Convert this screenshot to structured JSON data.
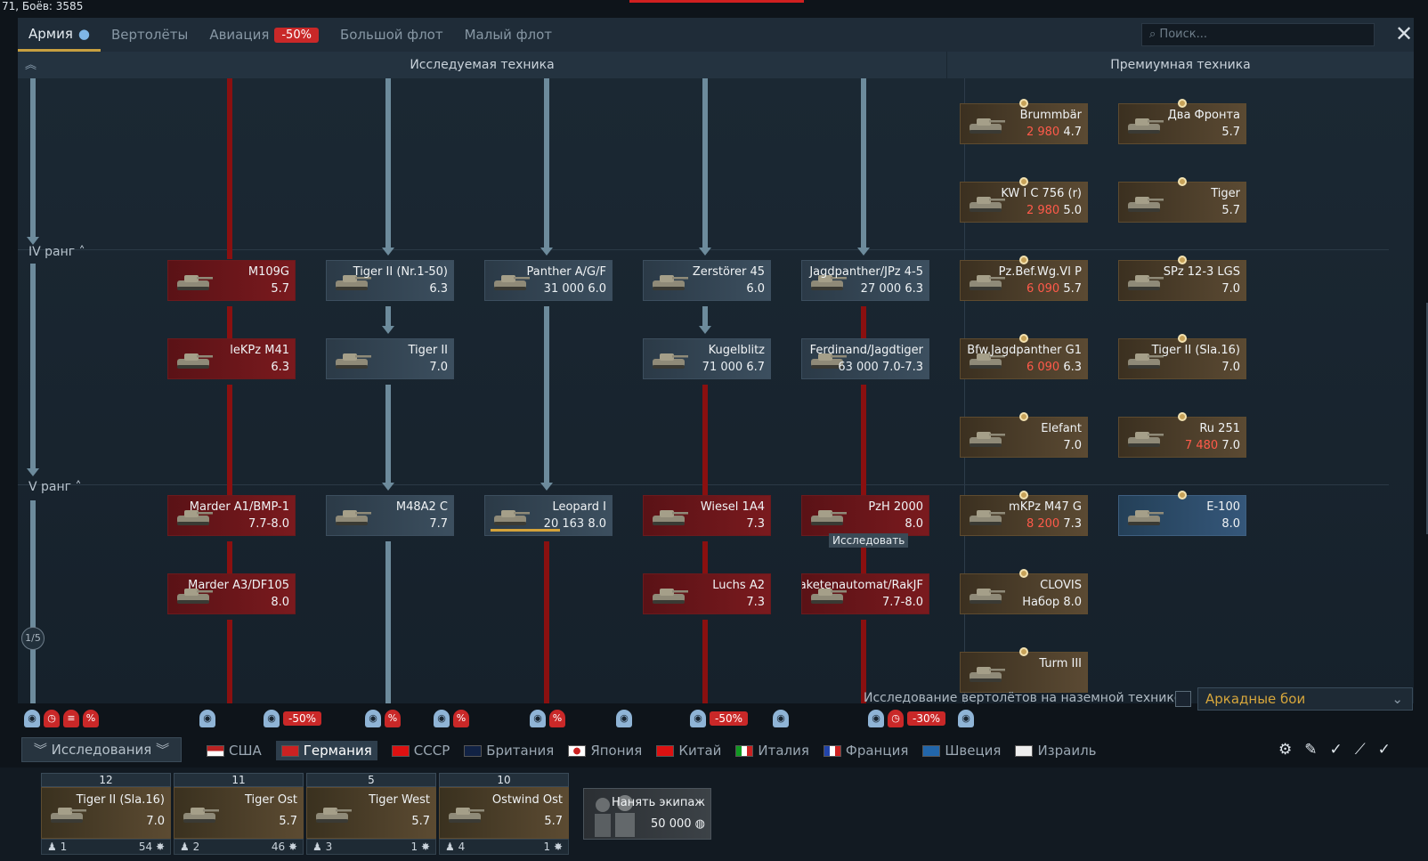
{
  "status_text": "71, Боёв: 3585",
  "tabs": [
    {
      "label": "Армия",
      "badge": ""
    },
    {
      "label": "Вертолёты",
      "badge": ""
    },
    {
      "label": "Авиация",
      "badge": "-50%"
    },
    {
      "label": "Большой флот",
      "badge": ""
    },
    {
      "label": "Малый флот",
      "badge": ""
    }
  ],
  "search_placeholder": "Поиск...",
  "headers": {
    "researchable": "Исследуемая техника",
    "premium": "Премиумная техника"
  },
  "ranks": {
    "r4": "IV ранг",
    "r5": "V ранг"
  },
  "tech_cards": [
    {
      "name": "M109G",
      "br": "5.7",
      "cost": "",
      "rp": "",
      "style": "loc"
    },
    {
      "name": "Tiger II (Nr.1-50)",
      "br": "6.3",
      "cost": "",
      "rp": "",
      "style": "std"
    },
    {
      "name": "Panther A/G/F",
      "br": "6.0",
      "cost": "",
      "rp": "31 000",
      "style": "std"
    },
    {
      "name": "Zerstörer 45",
      "br": "6.0",
      "cost": "",
      "rp": "",
      "style": "std"
    },
    {
      "name": "Jagdpanther/JPz 4-5",
      "br": "6.3",
      "cost": "",
      "rp": "27 000",
      "style": "std"
    },
    {
      "name": "leKPz M41",
      "br": "6.3",
      "cost": "",
      "rp": "",
      "style": "loc"
    },
    {
      "name": "Tiger II",
      "br": "7.0",
      "cost": "",
      "rp": "",
      "style": "std"
    },
    {
      "name": "Kugelblitz",
      "br": "6.7",
      "cost": "",
      "rp": "71 000",
      "style": "std"
    },
    {
      "name": "Ferdinand/Jagdtiger",
      "br": "7.0-7.3",
      "cost": "",
      "rp": "63 000",
      "style": "std"
    },
    {
      "name": "Marder A1/BMP-1",
      "br": "7.7-8.0",
      "cost": "",
      "rp": "",
      "style": "loc"
    },
    {
      "name": "M48A2 C",
      "br": "7.7",
      "cost": "",
      "rp": "",
      "style": "std"
    },
    {
      "name": "Leopard I",
      "br": "8.0",
      "cost": "",
      "rp": "20 163",
      "style": "std"
    },
    {
      "name": "Wiesel 1A4",
      "br": "7.3",
      "cost": "",
      "rp": "",
      "style": "loc"
    },
    {
      "name": "PzH 2000",
      "br": "8.0",
      "cost": "",
      "rp": "",
      "style": "loc"
    },
    {
      "name": "Marder A3/DF105",
      "br": "8.0",
      "cost": "",
      "rp": "",
      "style": "loc"
    },
    {
      "name": "Luchs A2",
      "br": "7.3",
      "cost": "",
      "rp": "",
      "style": "loc"
    },
    {
      "name": "Raketenautomat/RakJF",
      "br": "7.7-8.0",
      "cost": "",
      "rp": "",
      "style": "loc"
    }
  ],
  "research_tooltip": "Исследовать",
  "premium_cards": [
    {
      "name": "Brummbär",
      "br": "4.7",
      "cost": "2 980",
      "style": "prem"
    },
    {
      "name": "Два Фронта",
      "br": "5.7",
      "cost": "",
      "style": "prem"
    },
    {
      "name": "KW I C 756 (r)",
      "br": "5.0",
      "cost": "2 980",
      "style": "prem"
    },
    {
      "name": "Tiger",
      "br": "5.7",
      "cost": "",
      "style": "prem"
    },
    {
      "name": "Pz.Bef.Wg.VI P",
      "br": "5.7",
      "cost": "6 090",
      "style": "prem"
    },
    {
      "name": "SPz 12-3 LGS",
      "br": "7.0",
      "cost": "",
      "style": "prem"
    },
    {
      "name": "Bfw.Jagdpanther G1",
      "br": "6.3",
      "cost": "6 090",
      "style": "prem"
    },
    {
      "name": "Tiger II (Sla.16)",
      "br": "7.0",
      "cost": "",
      "style": "prem"
    },
    {
      "name": "Elefant",
      "br": "7.0",
      "cost": "",
      "style": "prem"
    },
    {
      "name": "Ru 251",
      "br": "7.0",
      "cost": "7 480",
      "style": "prem"
    },
    {
      "name": "mKPz M47 G",
      "br": "7.3",
      "cost": "8 200",
      "style": "prem"
    },
    {
      "name": "E-100",
      "br": "8.0",
      "cost": "",
      "style": "sq"
    },
    {
      "name": "CLOVIS",
      "br": "Набор 8.0",
      "cost": "",
      "style": "prem"
    },
    {
      "name": "Turm III",
      "br": "",
      "cost": "",
      "style": "prem"
    }
  ],
  "page_indicator": "1/5",
  "heli_label": "Исследование вертолётов на наземной технике",
  "game_mode": "Аркадные бои",
  "research_button": "Исследования",
  "nation_discounts": [
    "-50%",
    "-50%",
    "-30%"
  ],
  "nations": [
    "США",
    "Германия",
    "СССР",
    "Британия",
    "Япония",
    "Китай",
    "Италия",
    "Франция",
    "Швеция",
    "Израиль"
  ],
  "crew_slots": [
    {
      "count": "12",
      "name": "Tiger II (Sla.16)",
      "br": "7.0",
      "slot": "1",
      "exp": "54"
    },
    {
      "count": "11",
      "name": "Tiger Ost",
      "br": "5.7",
      "slot": "2",
      "exp": "46"
    },
    {
      "count": "5",
      "name": "Tiger West",
      "br": "5.7",
      "slot": "3",
      "exp": "1"
    },
    {
      "count": "10",
      "name": "Ostwind Ost",
      "br": "5.7",
      "slot": "4",
      "exp": "1"
    }
  ],
  "hire": {
    "label": "Нанять экипаж",
    "cost": "50 000"
  }
}
